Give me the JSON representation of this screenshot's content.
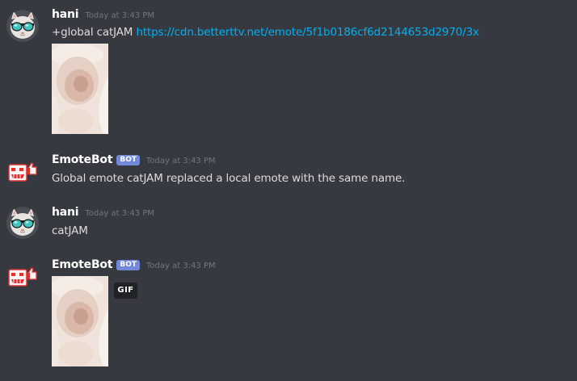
{
  "messages": [
    {
      "username": "hani",
      "timestamp": "Today at 3:43 PM",
      "text": "+global catJAM ",
      "link": "https://cdn.betterttv.net/emote/5f1b0186cf6d2144653d2970/3x"
    },
    {
      "username": "EmoteBot",
      "bot_tag": "BOT",
      "timestamp": "Today at 3:43 PM",
      "text": "Global emote catJAM replaced a local emote with the same name."
    },
    {
      "username": "hani",
      "timestamp": "Today at 3:43 PM",
      "text": "catJAM"
    },
    {
      "username": "EmoteBot",
      "bot_tag": "BOT",
      "timestamp": "Today at 3:43 PM",
      "gif_label": "GIF"
    }
  ],
  "colors": {
    "background": "#36393f",
    "username": "#ffffff",
    "message_text": "#dcddde",
    "timestamp": "#72767d",
    "link": "#00b0f4",
    "bot_tag": "#7289da"
  }
}
